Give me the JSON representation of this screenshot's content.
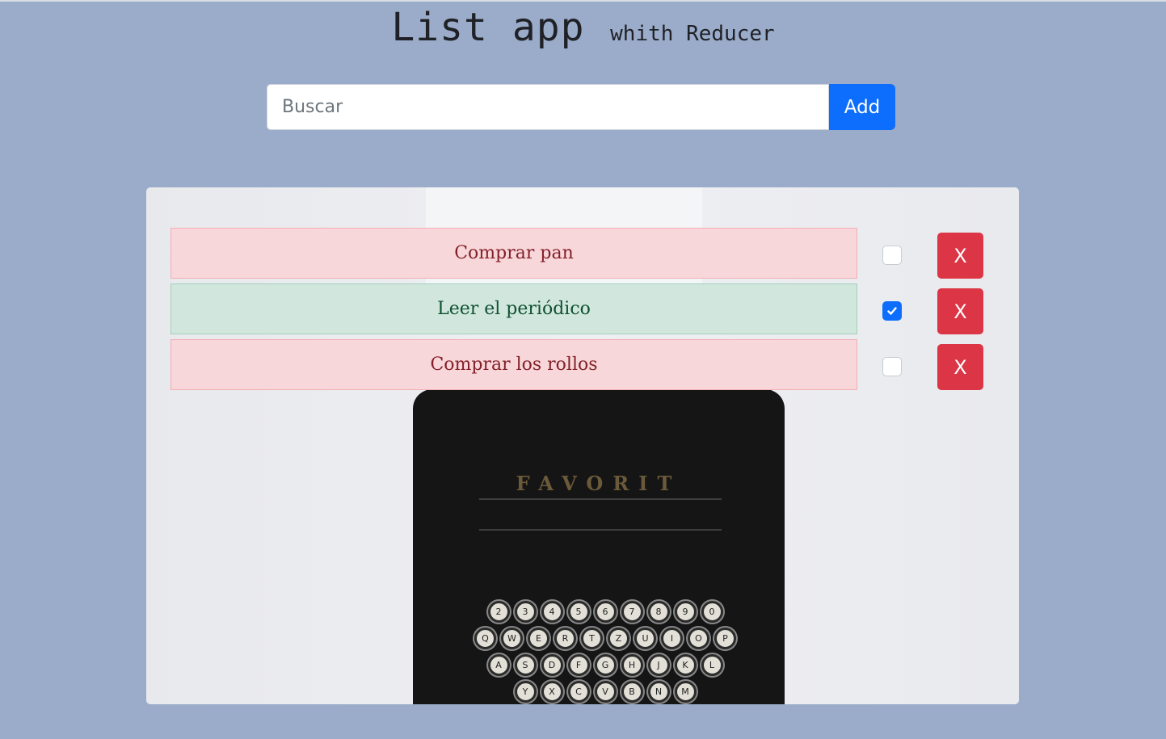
{
  "header": {
    "title": "List app",
    "subtitle": "whith Reducer"
  },
  "search": {
    "placeholder": "Buscar",
    "value": "",
    "add_label": "Add"
  },
  "colors": {
    "background": "#9aacca",
    "primary": "#0d6efd",
    "danger": "#dc3545",
    "pending_bg": "#f8d7da",
    "done_bg": "#d1e7dd"
  },
  "card_image": {
    "brand": "FAVORIT"
  },
  "todos": [
    {
      "text": "Comprar pan",
      "done": false,
      "delete_label": "X"
    },
    {
      "text": "Leer el periódico",
      "done": true,
      "delete_label": "X"
    },
    {
      "text": "Comprar los rollos",
      "done": false,
      "delete_label": "X"
    }
  ]
}
